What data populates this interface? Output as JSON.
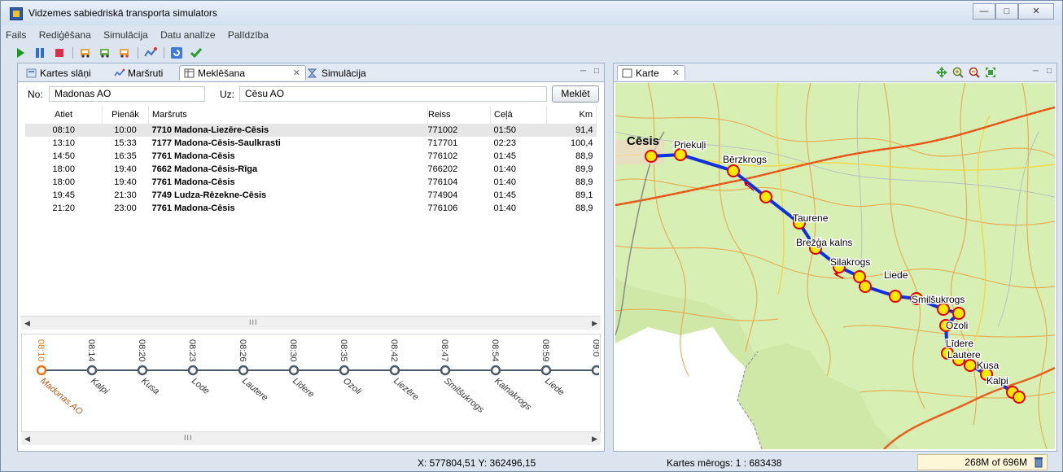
{
  "window": {
    "title": "Vidzemes sabiedriskā transporta simulators"
  },
  "menu": [
    "Fails",
    "Rediģēšana",
    "Simulācija",
    "Datu analīze",
    "Palīdzība"
  ],
  "left_panel": {
    "tabs": [
      "Kartes slāņi",
      "Maršruti",
      "Meklēšana",
      "Simulācija"
    ],
    "search": {
      "from_label": "No:",
      "from_value": "Madonas AO",
      "to_label": "Uz:",
      "to_value": "Cēsu AO",
      "button": "Meklēt"
    },
    "table": {
      "headers": [
        "Atiet",
        "Pienāk",
        "Maršruts",
        "Reiss",
        "Ceļā",
        "Km"
      ],
      "rows": [
        [
          "08:10",
          "10:00",
          "7710 Madona-Liezēre-Cēsis",
          "771002",
          "01:50",
          "91,4"
        ],
        [
          "13:10",
          "15:33",
          "7177 Madona-Cēsis-Saulkrasti",
          "717701",
          "02:23",
          "100,4"
        ],
        [
          "14:50",
          "16:35",
          "7761 Madona-Cēsis",
          "776102",
          "01:45",
          "88,9"
        ],
        [
          "18:00",
          "19:40",
          "7662 Madona-Cēsis-Rīga",
          "766202",
          "01:40",
          "89,9"
        ],
        [
          "18:00",
          "19:40",
          "7761 Madona-Cēsis",
          "776104",
          "01:40",
          "88,9"
        ],
        [
          "19:45",
          "21:30",
          "7749 Ludza-Rēzekne-Cēsis",
          "774904",
          "01:45",
          "89,1"
        ],
        [
          "21:20",
          "23:00",
          "7761 Madona-Cēsis",
          "776106",
          "01:40",
          "88,9"
        ]
      ]
    },
    "timeline": {
      "times": [
        "08:10",
        "08:14",
        "08:20",
        "08:23",
        "08:26",
        "08:30",
        "08:35",
        "08:42",
        "08:47",
        "08:54",
        "08:59",
        "09:0"
      ],
      "stops": [
        "Madonas AO",
        "Kalpi",
        "Kusa",
        "Lode",
        "Lautere",
        "Līdere",
        "Ozoli",
        "Liezēre",
        "Smilšukrogs",
        "Kalnakrogs",
        "Liede"
      ]
    }
  },
  "map_panel": {
    "tab": "Karte",
    "town": "Cēsis",
    "stops": [
      "Priekuļi",
      "Bērzkrogs",
      "Taurene",
      "Brežģa kalns",
      "Silakrogs",
      "Liede",
      "Smilšukrogs",
      "Ozoli",
      "Līdere",
      "Lautere",
      "Kusa",
      "Kalpi"
    ]
  },
  "status": {
    "coords": "X: 577804,51 Y: 362496,15",
    "scale": "Kartes mērogs: 1 : 683438",
    "memory": "268M of 696M"
  },
  "colors": {
    "route": "#1030e0",
    "stop_fill": "#ffe800",
    "stop_ring": "#e00000",
    "highlight": "#e8731a"
  }
}
